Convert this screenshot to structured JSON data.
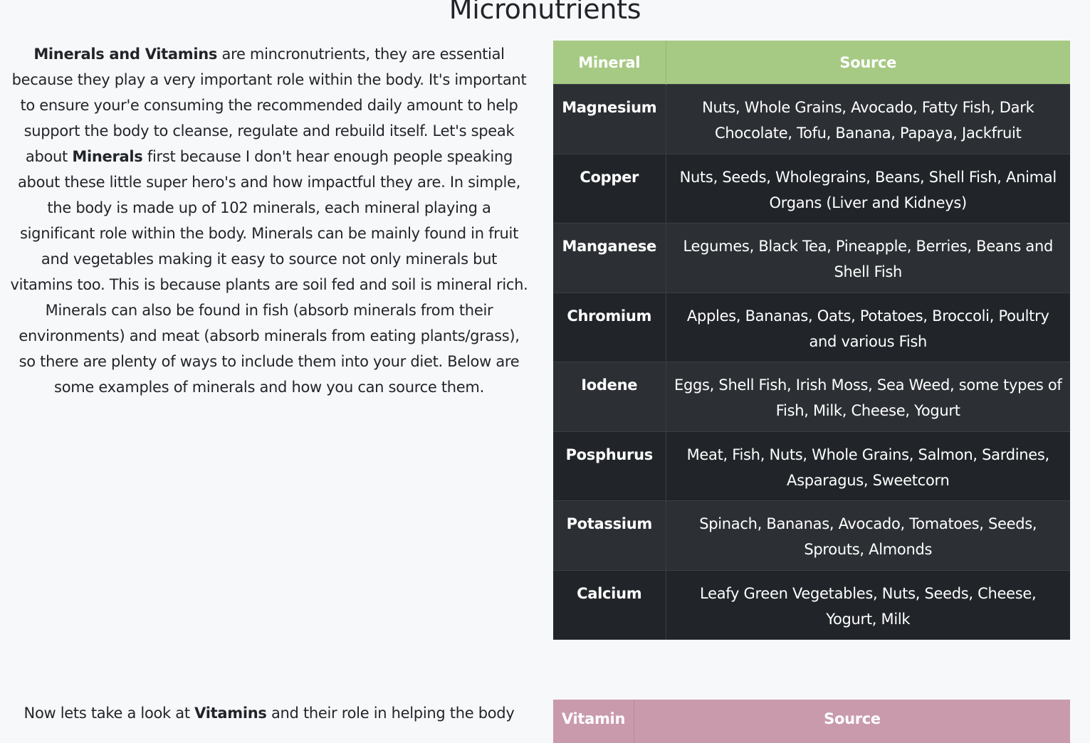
{
  "page": {
    "title": "Micronutrients"
  },
  "intro": {
    "lead_bold": "Minerals and Vitamins",
    "text_1": " are mincronutrients, they are essential because they play a very important role within the body. It's important to ensure your'e consuming the recommended daily amount to help support the body to cleanse, regulate and rebuild itself. Let's speak about ",
    "minerals_bold": "Minerals",
    "text_2": " first because I don't hear enough people speaking about these little super hero's and how impactful they are. In simple, the body is made up of 102 minerals, each mineral playing a significant role within the body. Minerals can be mainly found in fruit and vegetables making it easy to source not only minerals but vitamins too. This is because plants are soil fed and soil is mineral rich. Minerals can also be found in fish (absorb minerals from their environments) and meat (absorb minerals from eating plants/grass), so there are plenty of ways to include them into your diet. Below are some examples of minerals and how you can source them."
  },
  "minerals_table": {
    "headers": [
      "Mineral",
      "Source"
    ],
    "rows": [
      {
        "mineral": "Magnesium",
        "source": "Nuts, Whole Grains, Avocado, Fatty Fish, Dark Chocolate, Tofu, Banana, Papaya, Jackfruit"
      },
      {
        "mineral": "Copper",
        "source": "Nuts, Seeds, Wholegrains, Beans, Shell Fish, Animal Organs (Liver and Kidneys)"
      },
      {
        "mineral": "Manganese",
        "source": "Legumes, Black Tea, Pineapple, Berries, Beans and Shell Fish"
      },
      {
        "mineral": "Chromium",
        "source": "Apples, Bananas, Oats, Potatoes, Broccoli, Poultry and various Fish"
      },
      {
        "mineral": "Iodene",
        "source": "Eggs, Shell Fish, Irish Moss, Sea Weed, some types of Fish, Milk, Cheese, Yogurt"
      },
      {
        "mineral": "Posphurus",
        "source": "Meat, Fish, Nuts, Whole Grains, Salmon, Sardines, Asparagus, Sweetcorn"
      },
      {
        "mineral": "Potassium",
        "source": "Spinach, Bananas, Avocado, Tomatoes, Seeds, Sprouts, Almonds"
      },
      {
        "mineral": "Calcium",
        "source": "Leafy Green Vegetables, Nuts, Seeds, Cheese, Yogurt, Milk"
      }
    ]
  },
  "vitamins_intro": {
    "text_1": "Now lets take a look at ",
    "vitamins_bold": "Vitamins",
    "text_2": " and their role in helping the body"
  },
  "vitamins_table": {
    "headers": [
      "Vitamin",
      "Source"
    ]
  },
  "colors": {
    "page_background": "#f7f8fa",
    "minerals_header": "#a6c983",
    "vitamins_header": "#c99aac",
    "table_row_dark": "#212529",
    "table_row_striped": "#2c3034",
    "text": "#212529"
  }
}
